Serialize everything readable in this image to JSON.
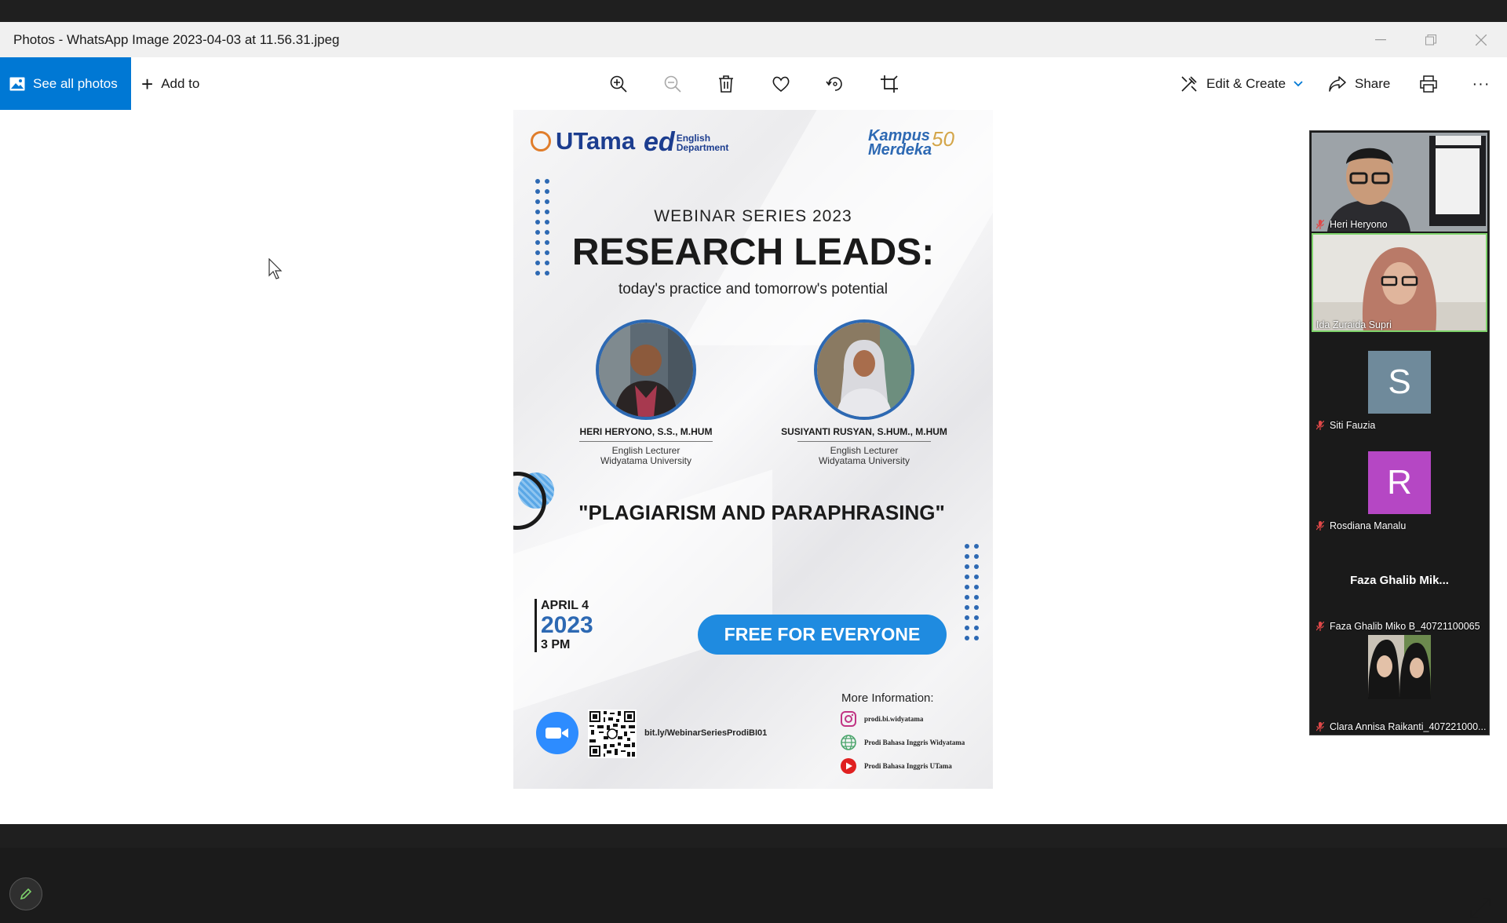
{
  "window": {
    "title": "Photos - WhatsApp Image 2023-04-03 at 11.56.31.jpeg"
  },
  "toolbar": {
    "see_all_photos": "See all photos",
    "add_to": "Add to",
    "edit_create": "Edit & Create",
    "share": "Share",
    "more": "···"
  },
  "poster": {
    "logo_utama": "UTama",
    "logo_ed_big": "ed",
    "logo_ed_line1": "English",
    "logo_ed_line2": "Department",
    "logo_km_line1": "Kampus",
    "logo_km_line2": "Merdeka",
    "logo_50": "50",
    "series": "WEBINAR SERIES 2023",
    "headline": "RESEARCH LEADS:",
    "subheadline": "today's practice and tomorrow's potential",
    "speakers": [
      {
        "name": "HERI HERYONO, S.S., M.HUM",
        "role_line1": "English Lecturer",
        "role_line2": "Widyatama University"
      },
      {
        "name": "SUSIYANTI RUSYAN, S.HUM., M.HUM",
        "role_line1": "English Lecturer",
        "role_line2": "Widyatama University"
      }
    ],
    "topic": "\"PLAGIARISM AND PARAPHRASING\"",
    "date_line1": "APRIL 4",
    "date_year": "2023",
    "date_time": "3 PM",
    "free_label": "FREE FOR EVERYONE",
    "link": "bit.ly/WebinarSeriesProdiBI01",
    "more_info": "More Information:",
    "socials": [
      {
        "label": "prodi.bi.widyatama",
        "icon": "instagram-icon"
      },
      {
        "label": "Prodi Bahasa Inggris Widyatama",
        "icon": "globe-icon"
      },
      {
        "label": "Prodi Bahasa Inggris UTama",
        "icon": "youtube-icon"
      }
    ]
  },
  "participants": [
    {
      "name": "Heri Heryono",
      "type": "video"
    },
    {
      "name": "Ida Zuraida Supri",
      "type": "video"
    },
    {
      "name": "Siti Fauzia",
      "type": "avatar",
      "initial": "S",
      "color": "#6f8a9b"
    },
    {
      "name": "Rosdiana Manalu",
      "type": "avatar",
      "initial": "R",
      "color": "#b547c4"
    },
    {
      "name": "Faza Ghalib Miko B_40721100065",
      "type": "name",
      "display": "Faza Ghalib Mik..."
    },
    {
      "name": "Clara Annisa Raikanti_407221000...",
      "type": "video"
    }
  ],
  "colors": {
    "accent": "#0078d4",
    "poster_blue": "#2d69b3",
    "free_button": "#1f8be0",
    "active_speaker_border": "#7ed36b"
  }
}
